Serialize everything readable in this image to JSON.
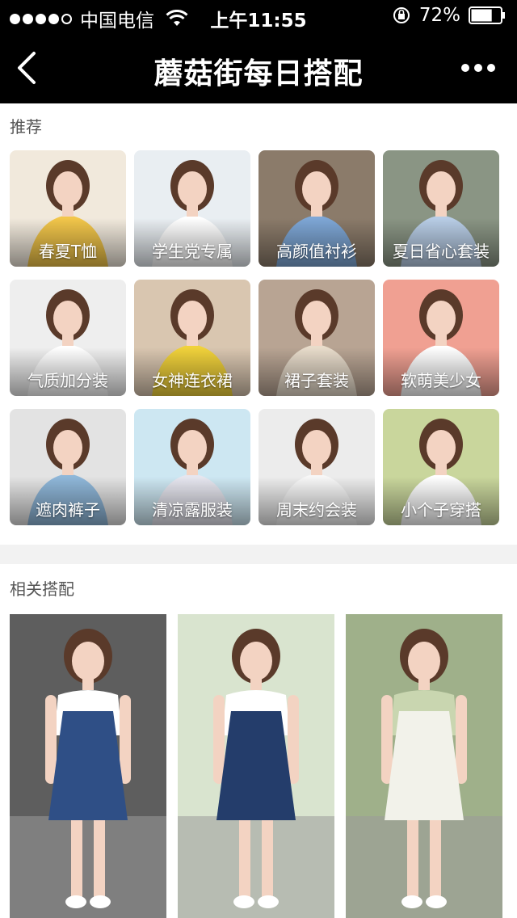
{
  "status_bar": {
    "carrier": "中国电信",
    "time": "上午11:55",
    "battery": "72%",
    "battery_level": 0.72
  },
  "nav": {
    "title": "蘑菇街每日搭配",
    "back_icon": "chevron-left-icon",
    "more_icon": "more-dots-icon"
  },
  "recommend": {
    "title": "推荐",
    "items": [
      {
        "label": "春夏T恤",
        "bg": "#f1e9dc",
        "cloth": "#f2c64a"
      },
      {
        "label": "学生党专属",
        "bg": "#e9eef2",
        "cloth": "#ffffff"
      },
      {
        "label": "高颜值衬衫",
        "bg": "#8b7b6a",
        "cloth": "#7ea7d6"
      },
      {
        "label": "夏日省心套装",
        "bg": "#8a9584",
        "cloth": "#b8cde6"
      },
      {
        "label": "气质加分装",
        "bg": "#eeeeee",
        "cloth": "#ffffff"
      },
      {
        "label": "女神连衣裙",
        "bg": "#d9c6b0",
        "cloth": "#f1d23b"
      },
      {
        "label": "裙子套装",
        "bg": "#b8a493",
        "cloth": "#e8dccb"
      },
      {
        "label": "软萌美少女",
        "bg": "#f0a092",
        "cloth": "#ffffff"
      },
      {
        "label": "遮肉裤子",
        "bg": "#e3e3e3",
        "cloth": "#8fb7d9"
      },
      {
        "label": "清凉露服装",
        "bg": "#cde7f2",
        "cloth": "#e6e6ef"
      },
      {
        "label": "周末约会装",
        "bg": "#ececec",
        "cloth": "#f7f7f7"
      },
      {
        "label": "小个子穿搭",
        "bg": "#c9d69c",
        "cloth": "#ffffff"
      }
    ]
  },
  "related": {
    "title": "相关搭配",
    "items": [
      {
        "bg": "#5e5e5e",
        "top": "#ffffff",
        "dress": "#2f4f86"
      },
      {
        "bg": "#d9e4cf",
        "top": "#ffffff",
        "dress": "#243d6b"
      },
      {
        "bg": "#9fb08a",
        "top": "#c9d6b0",
        "dress": "#f2f2ea"
      }
    ]
  },
  "colors": {
    "bar_bg": "#000000",
    "separator": "#f2f2f2",
    "skin": "#f3d3c2",
    "hair": "#5a3a2a"
  }
}
